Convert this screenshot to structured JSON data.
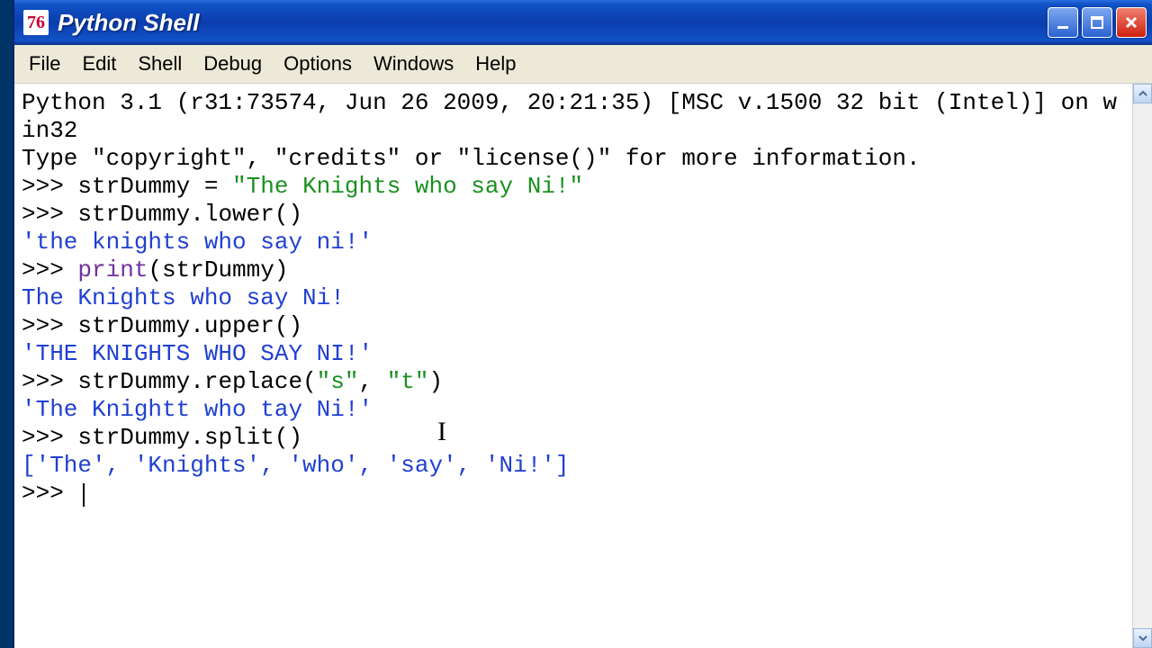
{
  "window": {
    "title": "Python Shell",
    "icon_text": "76"
  },
  "menu": {
    "items": [
      "File",
      "Edit",
      "Shell",
      "Debug",
      "Options",
      "Windows",
      "Help"
    ]
  },
  "shell": {
    "header_line1": "Python 3.1 (r31:73574, Jun 26 2009, 20:21:35) [MSC v.1500 32 bit (Intel)] on win32",
    "header_line2": "Type \"copyright\", \"credits\" or \"license()\" for more information.",
    "prompt": ">>> ",
    "entries": [
      {
        "in_pre": "strDummy = ",
        "in_str": "\"The Knights who say Ni!\"",
        "out": ""
      },
      {
        "in_pre": "strDummy.lower()",
        "in_str": "",
        "out": "'the knights who say ni!'"
      },
      {
        "in_builtin": "print",
        "in_args": "(strDummy)",
        "out": "The Knights who say Ni!"
      },
      {
        "in_pre": "strDummy.upper()",
        "in_str": "",
        "out": "'THE KNIGHTS WHO SAY NI!'"
      },
      {
        "in_pre": "strDummy.replace(",
        "in_str1": "\"s\"",
        "in_mid": ", ",
        "in_str2": "\"t\"",
        "in_post": ")",
        "out": "'The Knightt who tay Ni!'"
      },
      {
        "in_pre": "strDummy.split()",
        "in_str": "",
        "out": "['The', 'Knights', 'who', 'say', 'Ni!']"
      }
    ]
  }
}
